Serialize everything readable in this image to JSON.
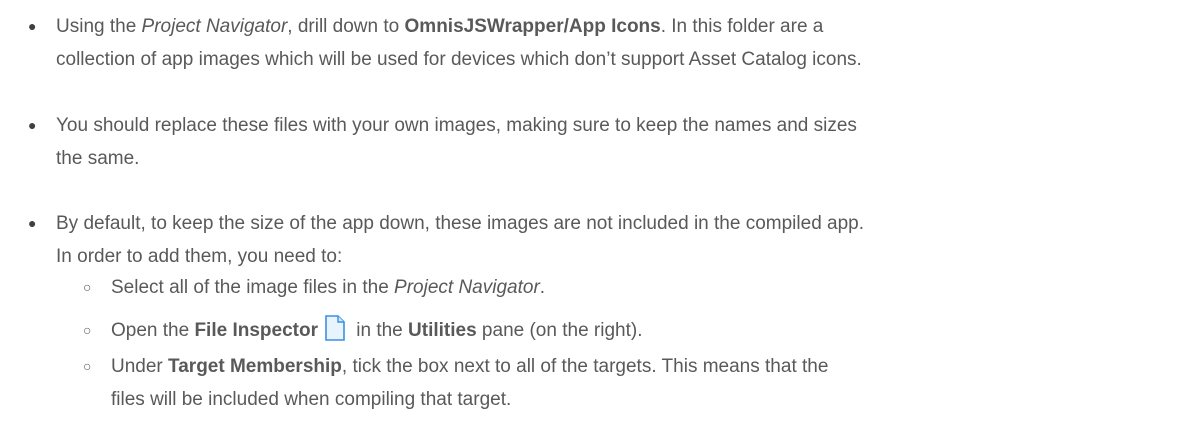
{
  "bullets": [
    {
      "p1": "Using the ",
      "p2": "Project Navigator",
      "p3": ", drill down to ",
      "p4": "OmnisJSWrapper/App Icons",
      "p5": ". In this folder are a",
      "line2": "collection of app images which will be used for devices which don’t support Asset Catalog icons."
    },
    {
      "line1": "You should replace these files with your own images, making sure to keep the names and sizes",
      "line2": "the same."
    },
    {
      "line1": "By default, to keep the size of the app down, these images are not included in the compiled app.",
      "line2": "In order to add them, you need to:"
    }
  ],
  "sub_items": [
    {
      "p1": "Select all of the image files in the ",
      "p2": "Project Navigator",
      "p3": "."
    },
    {
      "p1": "Open the ",
      "p2": "File Inspector",
      "p3": " in the ",
      "p4": "Utilities",
      "p5": " pane (on the right)."
    },
    {
      "p1": "Under ",
      "p2": "Target Membership",
      "p3": ", tick the box next to all of the targets. This means that the",
      "line2": "files will be included when compiling that target."
    }
  ],
  "markers": {
    "bullet": "●",
    "sub_bullet": "○"
  },
  "icons": {
    "file_inspector": "document-icon"
  },
  "colors": {
    "text": "#595959",
    "icon_fill": "#e8f4fd",
    "icon_stroke": "#3b8fe0"
  }
}
